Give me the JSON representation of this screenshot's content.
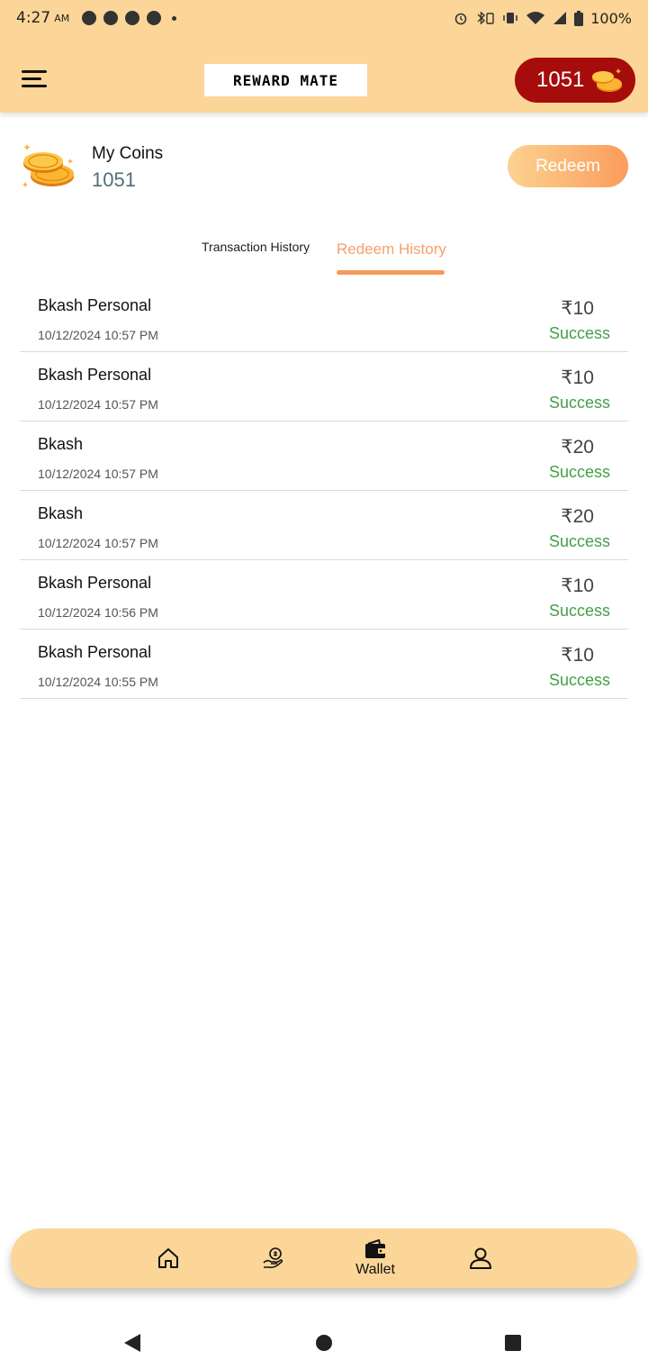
{
  "status_bar": {
    "time": "4:27",
    "ampm": "AM",
    "battery": "100%",
    "icons": [
      "alarm-icon",
      "bluetooth-icon",
      "vibrate-icon",
      "wifi-icon",
      "signal-icon",
      "battery-icon"
    ]
  },
  "app_bar": {
    "title": "REWARD MATE",
    "coin_balance": "1051"
  },
  "my_coins": {
    "label": "My Coins",
    "value": "1051",
    "redeem_label": "Redeem"
  },
  "tabs": {
    "transaction": "Transaction History",
    "redeem": "Redeem History",
    "active": "redeem"
  },
  "history": [
    {
      "name": "Bkash Personal",
      "date": "10/12/2024 10:57 PM",
      "amount": "₹10",
      "status": "Success"
    },
    {
      "name": "Bkash Personal",
      "date": "10/12/2024 10:57 PM",
      "amount": "₹10",
      "status": "Success"
    },
    {
      "name": "Bkash",
      "date": "10/12/2024 10:57 PM",
      "amount": "₹20",
      "status": "Success"
    },
    {
      "name": "Bkash",
      "date": "10/12/2024 10:57 PM",
      "amount": "₹20",
      "status": "Success"
    },
    {
      "name": "Bkash Personal",
      "date": "10/12/2024 10:56 PM",
      "amount": "₹10",
      "status": "Success"
    },
    {
      "name": "Bkash Personal",
      "date": "10/12/2024 10:55 PM",
      "amount": "₹10",
      "status": "Success"
    }
  ],
  "bottom_nav": {
    "wallet_label": "Wallet",
    "items": [
      "home-icon",
      "earn-icon",
      "wallet-icon",
      "profile-icon"
    ]
  },
  "colors": {
    "header_bg": "#fbd698",
    "accent_orange": "#f79a5b",
    "coin_pill": "#a70c0c",
    "success": "#43a047"
  }
}
